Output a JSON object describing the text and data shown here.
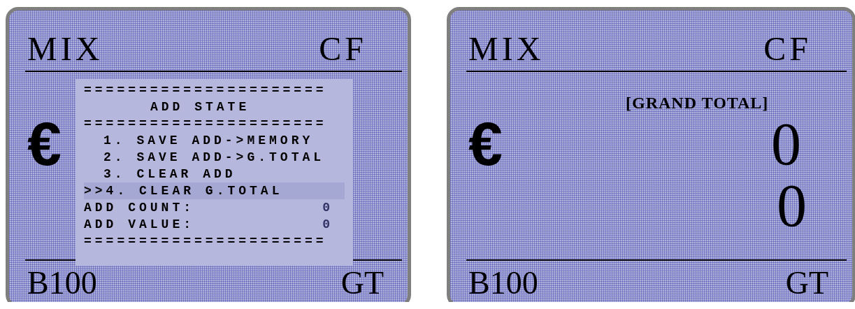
{
  "screens": [
    {
      "header_left": "MIX",
      "header_right": "CF",
      "currency": "€",
      "footer_left": "B100",
      "footer_right": "GT",
      "popup": {
        "lines": [
          {
            "kind": "separator",
            "text": "======================"
          },
          {
            "kind": "title",
            "text": "ADD STATE"
          },
          {
            "kind": "separator",
            "text": "======================"
          },
          {
            "kind": "item",
            "number": "1.",
            "label": "SAVE  ADD->MEMORY",
            "selected": false
          },
          {
            "kind": "item",
            "number": "2.",
            "label": "SAVE  ADD->G.TOTAL",
            "selected": false
          },
          {
            "kind": "item",
            "number": "3.",
            "label": "CLEAR ADD",
            "selected": false
          },
          {
            "kind": "item",
            "pointer": ">>",
            "number": "4.",
            "label": "CLEAR G.TOTAL",
            "selected": true
          },
          {
            "kind": "field",
            "label": "ADD COUNT:",
            "value": "0"
          },
          {
            "kind": "field",
            "label": "ADD VALUE:",
            "value": "0"
          },
          {
            "kind": "separator",
            "text": "======================"
          }
        ]
      }
    },
    {
      "header_left": "MIX",
      "header_right": "CF",
      "title": "[GRAND TOTAL]",
      "currency": "€",
      "readings": [
        "0",
        "0"
      ],
      "footer_left": "B100",
      "footer_right": "GT"
    }
  ]
}
